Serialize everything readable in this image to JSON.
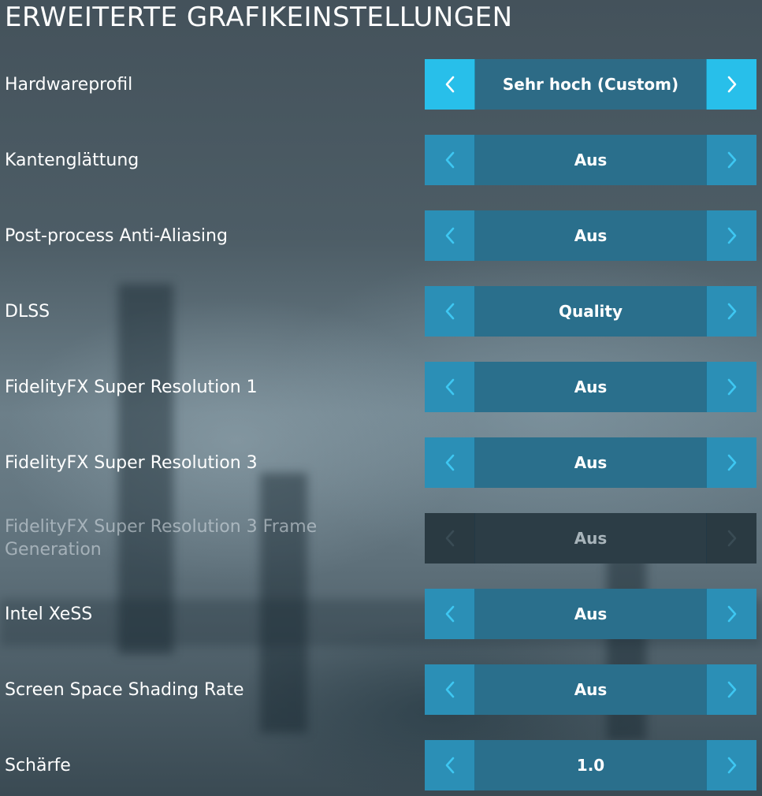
{
  "page": {
    "title": "ERWEITERTE GRAFIKEINSTELLUNGEN"
  },
  "colors": {
    "accent_active": "#28bfea",
    "arrow_bg": "#2b8fb6",
    "value_bg": "#2a6f8c",
    "disabled_bg": "#2c3d46"
  },
  "icons": {
    "prev": "chevron-left-icon",
    "next": "chevron-right-icon"
  },
  "settings": [
    {
      "label": "Hardwareprofil",
      "value": "Sehr hoch (Custom)",
      "state": "active"
    },
    {
      "label": "Kantenglättung",
      "value": "Aus",
      "state": "normal"
    },
    {
      "label": "Post-process Anti-Aliasing",
      "value": "Aus",
      "state": "normal"
    },
    {
      "label": "DLSS",
      "value": "Quality",
      "state": "normal"
    },
    {
      "label": "FidelityFX Super Resolution 1",
      "value": "Aus",
      "state": "normal"
    },
    {
      "label": "FidelityFX Super Resolution 3",
      "value": "Aus",
      "state": "normal"
    },
    {
      "label": "FidelityFX Super Resolution 3 Frame Generation",
      "value": "Aus",
      "state": "disabled"
    },
    {
      "label": "Intel XeSS",
      "value": "Aus",
      "state": "normal"
    },
    {
      "label": "Screen Space Shading Rate",
      "value": "Aus",
      "state": "normal"
    },
    {
      "label": "Schärfe",
      "value": "1.0",
      "state": "normal"
    }
  ]
}
